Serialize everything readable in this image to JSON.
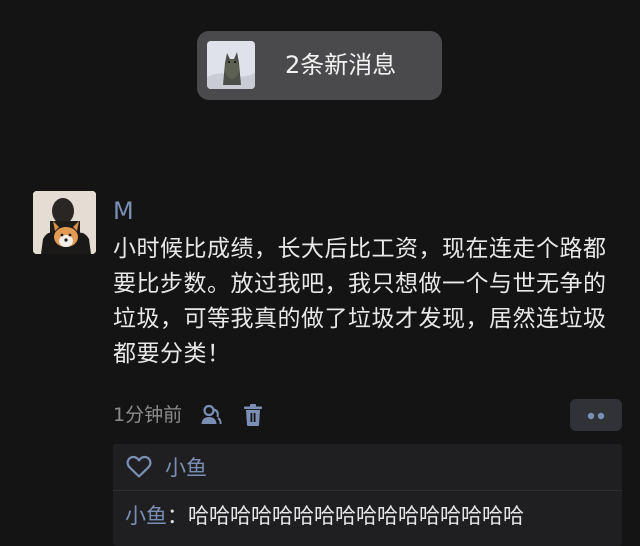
{
  "notification": {
    "new_messages_label": "2条新消息"
  },
  "post": {
    "author": "M",
    "content": "小时候比成绩，长大后比工资，现在连走个路都要比步数。放过我吧，我只想做一个与世无争的垃圾，可等我真的做了垃圾才发现，居然连垃圾都要分类！",
    "time": "1分钟前",
    "icons": {
      "author_icon": "person-icon",
      "delete_icon": "trash-icon",
      "more_icon": "more-dots-icon"
    }
  },
  "likes": {
    "icon": "heart-outline-icon",
    "names": "小鱼"
  },
  "comments": [
    {
      "author": "小鱼",
      "separator": "：",
      "text": "哈哈哈哈哈哈哈哈哈哈哈哈哈哈哈哈"
    }
  ],
  "colors": {
    "background": "#141414",
    "name_accent": "#7b8fb5",
    "pill_bg": "#4a4a4c",
    "panel_bg": "#1f1f21"
  }
}
